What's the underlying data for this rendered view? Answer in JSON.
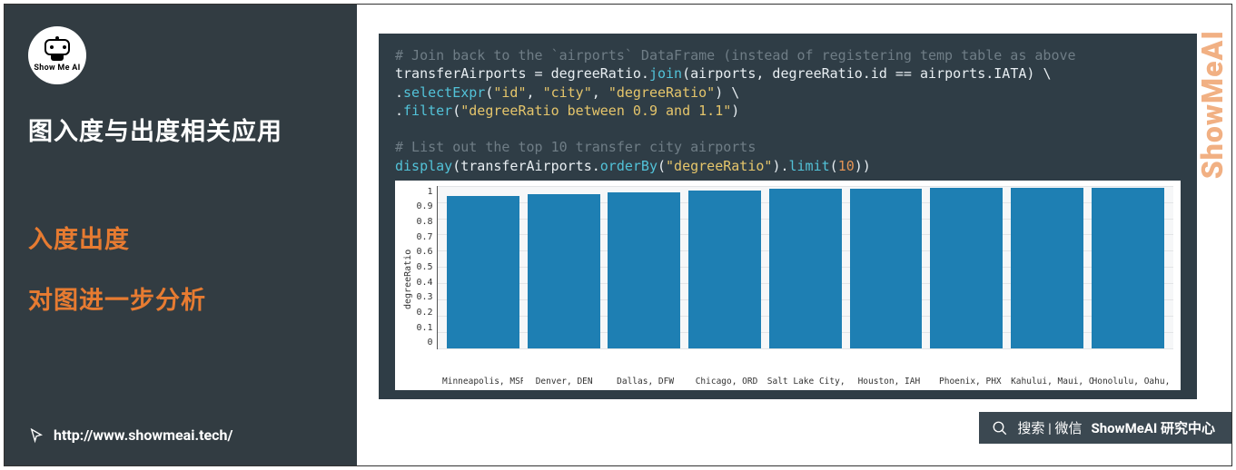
{
  "sidebar": {
    "logo_text": "Show Me AI",
    "title": "图入度与出度相关应用",
    "highlight1": "入度出度",
    "highlight2": "对图进一步分析",
    "link": "http://www.showmeai.tech/"
  },
  "code": {
    "line1_comment": "# Join back to the `airports` DataFrame (instead of registering temp table as above",
    "line2a": "transferAirports ",
    "line2b": "=",
    "line2c": " degreeRatio.",
    "line2d": "join",
    "line2e": "(airports, degreeRatio.id ",
    "line2f": "==",
    "line2g": " airports.IATA) \\",
    "line3a": "    .",
    "line3b": "selectExpr",
    "line3c": "(",
    "line3d": "\"id\"",
    "line3e": ", ",
    "line3f": "\"city\"",
    "line3g": ", ",
    "line3h": "\"degreeRatio\"",
    "line3i": ") \\",
    "line4a": "    .",
    "line4b": "filter",
    "line4c": "(",
    "line4d": "\"degreeRatio between 0.9 and 1.1\"",
    "line4e": ")",
    "line6_comment": "# List out the top 10 transfer city airports",
    "line7a": "display",
    "line7b": "(transferAirports.",
    "line7c": "orderBy",
    "line7d": "(",
    "line7e": "\"degreeRatio\"",
    "line7f": ").",
    "line7g": "limit",
    "line7h": "(",
    "line7i": "10",
    "line7j": "))"
  },
  "chart_data": {
    "type": "bar",
    "ylabel": "degreeRatio",
    "ylim": [
      0,
      1
    ],
    "y_ticks": [
      "1",
      "0.9",
      "0.8",
      "0.7",
      "0.6",
      "0.5",
      "0.4",
      "0.3",
      "0.2",
      "0.1",
      "0"
    ],
    "categories": [
      "Minneapolis, MSP",
      "Denver, DEN",
      "Dallas, DFW",
      "Chicago, ORD",
      "Salt Lake City, SLC",
      "Houston, IAH",
      "Phoenix, PHX",
      "Kahului, Maui, OGG",
      "Honolulu, Oahu, HNL"
    ],
    "values": [
      0.94,
      0.95,
      0.96,
      0.97,
      0.98,
      0.98,
      0.99,
      0.99,
      0.99
    ]
  },
  "search": {
    "label": "搜索 | 微信",
    "strong": "ShowMeAI 研究中心"
  },
  "watermark": "ShowMeAI"
}
